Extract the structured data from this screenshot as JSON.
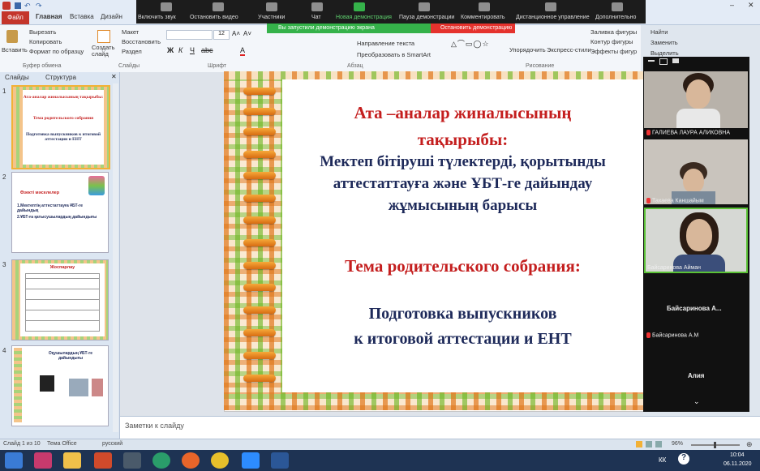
{
  "title_bar": {
    "file_tab": "Файл"
  },
  "ribbon_tabs": [
    "Главная",
    "Вставка",
    "Дизайн"
  ],
  "ribbon": {
    "paste": "Вставить",
    "cut": "Вырезать",
    "copy": "Копировать",
    "format_painter": "Формат по образцу",
    "clipboard_group": "Буфер обмена",
    "create_slide": "Создать слайд",
    "layout": "Макет",
    "reset": "Восстановить",
    "section": "Раздел",
    "slides_group": "Слайды",
    "font_group": "Шрифт",
    "paragraph_group": "Абзац",
    "text_direction": "Направление текста",
    "convert_smartart": "Преобразовать в SmartArt",
    "arrange": "Упорядочить",
    "quick_styles": "Экспресс-стили",
    "drawing_group": "Рисование",
    "fill": "Заливка фигуры",
    "outline": "Контур фигуры",
    "effects": "Эффекты фигур",
    "find": "Найти",
    "replace": "Заменить",
    "select": "Выделить",
    "font_size": "12"
  },
  "zoom_toolbar": {
    "items": [
      "Включить звук",
      "Остановить видео",
      "Участники",
      "Чат",
      "Новая демонстрация",
      "Пауза демонстрации",
      "Комментировать",
      "Дистанционное управление",
      "Дополнительно"
    ],
    "share_banner": "Вы запустили демонстрацию экрана",
    "stop_share": "Остановить демонстрацию"
  },
  "slide_panel": {
    "tabs": [
      "Слайды",
      "Структура"
    ],
    "thumb_numbers": [
      "1",
      "2",
      "3",
      "4"
    ],
    "thumb1_lines": [
      "Ата-аналар жиналысының тақырыбы:",
      "Тема родительского собрания",
      "Подготовка выпускников к итоговой аттестации и ЕНТ"
    ],
    "thumb2_lines": [
      "Өзекті мәселелер",
      "1.Мектептің аттестаттауға ҰБТ-ге дайындық",
      "2.ҰБТ-ға қатысушылардың дайындығы"
    ],
    "thumb3_title": "Жоспарлау",
    "thumb4_title": "Оқушылардың ҰБТ-ге дайындығы"
  },
  "slide": {
    "line1": "Ата –аналар жиналысының",
    "line2": "тақырыбы:",
    "line3": "Мектеп бітіруші түлектерді, қорытынды",
    "line4": "аттестаттауға және ҰБТ-ге дайындау",
    "line5": "жұмысының барысы",
    "line6": "Тема родительского собрания:",
    "line7": "Подготовка выпускников",
    "line8": "к итоговой аттестации и ЕНТ"
  },
  "notes": {
    "placeholder": "Заметки к слайду"
  },
  "status": {
    "slide_count": "Слайд 1 из 10",
    "theme": "Тема Office",
    "language": "русский",
    "zoom": "96%"
  },
  "participants": {
    "p1_name": "ГАЛИЕВА ЛАУРА АЛИКОВНА",
    "p2_name": "Тахаева Каншайым",
    "p3_name": "Байсаринова Айман",
    "p4_name": "Байсаринова А...",
    "p4_sub": "Байсаринова А.М",
    "p5_name": "Алия"
  },
  "taskbar": {
    "lang": "КК",
    "time": "10:04",
    "date": "06.11.2020"
  },
  "colors": {
    "title_red": "#c41e1e",
    "body_navy": "#1e2a5a",
    "share_green": "#35b24a",
    "stop_red": "#e5322d"
  }
}
